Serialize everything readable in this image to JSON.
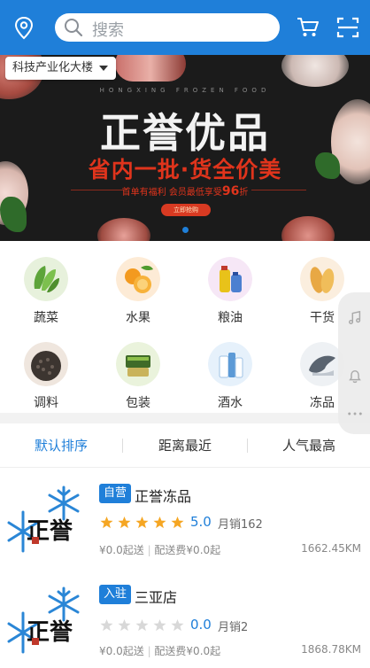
{
  "header": {
    "search_placeholder": "搜索",
    "location": "科技产业化大楼"
  },
  "banner": {
    "subtitle": "HONGXING FROZEN FOOD",
    "title": "正誉优品",
    "slogan": "省内一批·货全价美",
    "promo_prefix": "首单有福利 会员最低享受",
    "promo_discount": "96",
    "promo_suffix": "折",
    "button": "立即抢购"
  },
  "categories": [
    {
      "label": "蔬菜",
      "icon": "vegetables-icon"
    },
    {
      "label": "水果",
      "icon": "fruit-icon"
    },
    {
      "label": "粮油",
      "icon": "grain-oil-icon"
    },
    {
      "label": "干货",
      "icon": "dry-goods-icon"
    },
    {
      "label": "调料",
      "icon": "seasoning-icon"
    },
    {
      "label": "包装",
      "icon": "packaging-icon"
    },
    {
      "label": "酒水",
      "icon": "drinks-icon"
    },
    {
      "label": "冻品",
      "icon": "frozen-food-icon"
    }
  ],
  "sort": {
    "default": "默认排序",
    "nearest": "距离最近",
    "popular": "人气最高"
  },
  "stores": [
    {
      "badge": "自营",
      "name": "正誉冻品",
      "rating": "5.0",
      "stars": 5,
      "sales": "月销162",
      "min_order": "¥0.0起送",
      "delivery_fee": "配送费¥0.0起",
      "distance": "1662.45KM",
      "logo_text": "正誉"
    },
    {
      "badge": "入驻",
      "name": "三亚店",
      "rating": "0.0",
      "stars": 0,
      "sales": "月销2",
      "min_order": "¥0.0起送",
      "delivery_fee": "配送费¥0.0起",
      "distance": "1868.78KM",
      "logo_text": "正誉"
    }
  ],
  "colors": {
    "primary": "#1f7fd9",
    "star": "#f5a623",
    "banner_red": "#e0341c"
  }
}
